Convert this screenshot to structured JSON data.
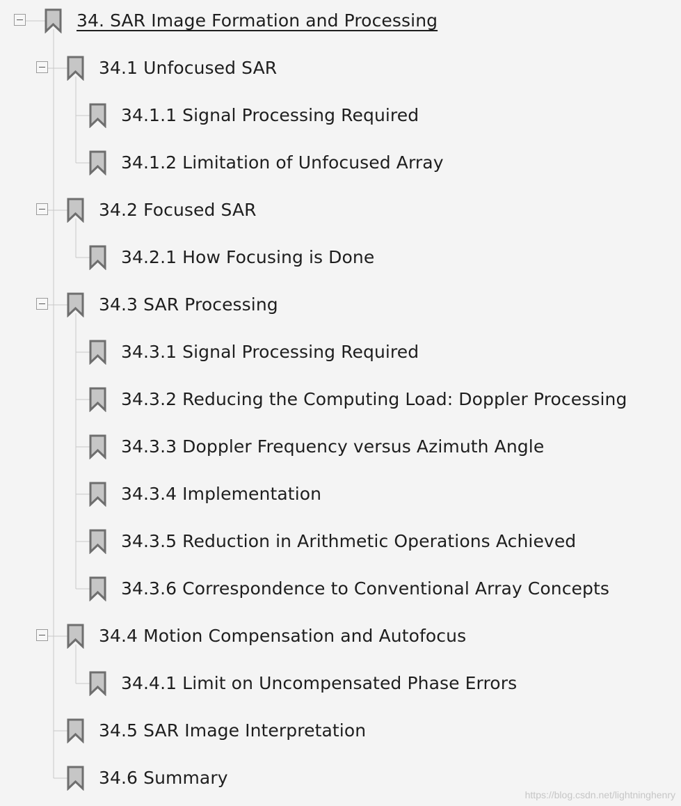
{
  "bookmarks_panel": {
    "items": [
      {
        "label": "34. SAR Image Formation and Processing",
        "level": 0,
        "expanded": true,
        "selected": true
      },
      {
        "label": "34.1 Unfocused SAR",
        "level": 1,
        "expanded": true
      },
      {
        "label": "34.1.1 Signal Processing Required",
        "level": 2
      },
      {
        "label": "34.1.2 Limitation of Unfocused Array",
        "level": 2
      },
      {
        "label": "34.2 Focused SAR",
        "level": 1,
        "expanded": true
      },
      {
        "label": "34.2.1 How Focusing is Done",
        "level": 2
      },
      {
        "label": "34.3 SAR Processing",
        "level": 1,
        "expanded": true
      },
      {
        "label": "34.3.1 Signal Processing Required",
        "level": 2
      },
      {
        "label": "34.3.2 Reducing the Computing Load: Doppler Processing",
        "level": 2
      },
      {
        "label": "34.3.3 Doppler Frequency versus Azimuth Angle",
        "level": 2
      },
      {
        "label": "34.3.4 Implementation",
        "level": 2
      },
      {
        "label": "34.3.5 Reduction in Arithmetic Operations Achieved",
        "level": 2
      },
      {
        "label": "34.3.6 Correspondence to Conventional Array Concepts",
        "level": 2
      },
      {
        "label": "34.4 Motion Compensation and Autofocus",
        "level": 1,
        "expanded": true
      },
      {
        "label": "34.4.1 Limit on Uncompensated Phase Errors",
        "level": 2
      },
      {
        "label": "34.5 SAR Image Interpretation",
        "level": 1
      },
      {
        "label": "34.6 Summary",
        "level": 1
      }
    ]
  },
  "watermark": "https://blog.csdn.net/lightninghenry",
  "colors": {
    "background": "#f4f4f4",
    "text": "#1e1e1e",
    "tree_line": "#c8c8c8",
    "bookmark_fill": "#c6c6c6",
    "bookmark_stroke": "#6e6e6e"
  },
  "icons": {
    "toggle": "collapse-minus-icon",
    "bookmark": "bookmark-ribbon-icon"
  }
}
